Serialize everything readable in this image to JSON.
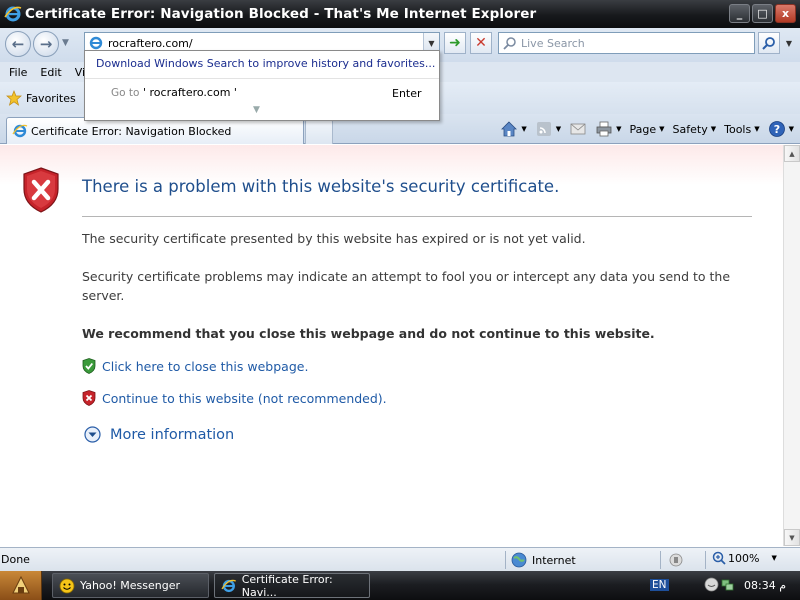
{
  "window": {
    "title": "Certificate Error: Navigation Blocked - That's Me Internet Explorer",
    "buttons": {
      "minimize": "_",
      "maximize": "□",
      "close": "x"
    }
  },
  "address_bar": {
    "url": "rocraftero.com/",
    "search_placeholder": "Live Search"
  },
  "address_dropdown": {
    "download_link": "Download Windows Search to improve history and favorites...",
    "goto_label": "Go to",
    "goto_url": "' rocraftero.com '",
    "enter_label": "Enter"
  },
  "menu": {
    "items": [
      "File",
      "Edit",
      "Vi"
    ]
  },
  "favorites_bar": {
    "label": "Favorites"
  },
  "tabs": [
    {
      "label": "Certificate Error: Navigation Blocked",
      "active": true
    }
  ],
  "command_bar": {
    "page": "Page",
    "safety": "Safety",
    "tools": "Tools"
  },
  "content": {
    "heading": "There is a problem with this website's security certificate.",
    "para1": "The security certificate presented by this website has expired or is not yet valid.",
    "para2": "Security certificate problems may indicate an attempt to fool you or intercept any data you send to the server.",
    "recommend": "We recommend that you close this webpage and do not continue to this website.",
    "close_link": "Click here to close this webpage.",
    "continue_link": "Continue to this website (not recommended).",
    "more_info": "More information"
  },
  "status_bar": {
    "status": "Done",
    "zone": "Internet",
    "zoom": "100%"
  },
  "taskbar": {
    "items": [
      {
        "label": "Yahoo! Messenger"
      },
      {
        "label": "Certificate Error: Navi..."
      }
    ],
    "language": "EN",
    "clock": "08:34 م"
  },
  "colors": {
    "link": "#1f5aa6",
    "heading": "#1f4e8c",
    "shield_red": "#c6232a",
    "shield_green": "#3a9a3a"
  },
  "icons": [
    "ie-logo-icon",
    "back-icon",
    "forward-icon",
    "go-icon",
    "stop-icon",
    "search-icon",
    "star-icon",
    "home-icon",
    "rss-icon",
    "mail-icon",
    "print-icon",
    "help-icon",
    "shield-error-icon",
    "shield-ok-icon",
    "chevron-down-circle-icon",
    "globe-icon"
  ]
}
